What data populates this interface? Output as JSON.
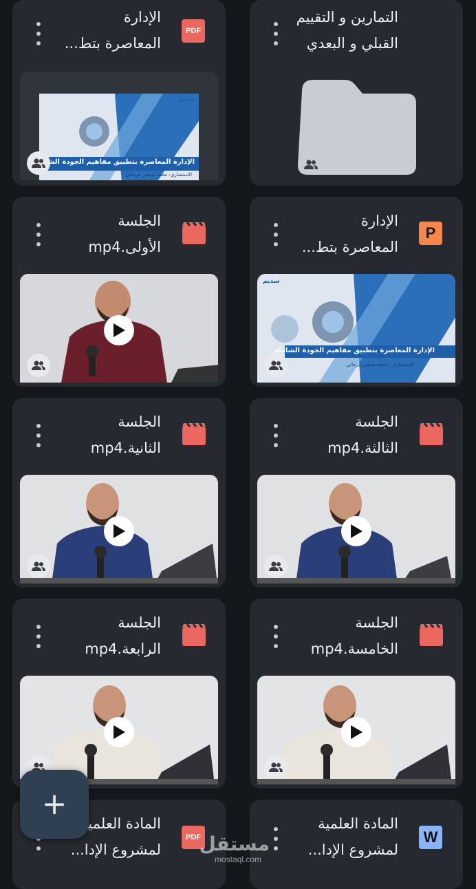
{
  "items": [
    {
      "title_line1": "التمارين و التقييم",
      "title_line2": "القبلي و البعدي",
      "type_icon": "folder"
    },
    {
      "title_line1": "الإدارة",
      "title_line2": "المعاصرة بتط...",
      "type_icon": "pdf-icon",
      "badge": "PDF",
      "thumb_title": "الإدارة المعاصرة بتطبيق مفاهيم الجودة الشاملة",
      "thumb_sub": "الاستشاري: محمد صبحي مرجاني",
      "thumb_brand": "سديم"
    },
    {
      "title_line1": "الإدارة",
      "title_line2": "المعاصرة بتط...",
      "type_icon": "presentation-icon",
      "badge": "P",
      "thumb_title": "الإدارة المعاصرة بتطبيق مفاهيم الجودة الشاملة",
      "thumb_sub": "الإستشاري : محمد صبحي مرجاني",
      "thumb_brand": "سديم"
    },
    {
      "title_line1": "الجلسة",
      "title_line2": "الأولى.mp4",
      "type_icon": "video-icon"
    },
    {
      "title_line1": "الجلسة",
      "title_line2": "الثالثة.mp4",
      "type_icon": "video-icon"
    },
    {
      "title_line1": "الجلسة",
      "title_line2": "الثانية.mp4",
      "type_icon": "video-icon"
    },
    {
      "title_line1": "الجلسة",
      "title_line2": "الخامسة.mp4",
      "type_icon": "video-icon"
    },
    {
      "title_line1": "الجلسة",
      "title_line2": "الرابعة.mp4",
      "type_icon": "video-icon"
    },
    {
      "title_line1": "المادة العلمية",
      "title_line2": "لمشروع الإدا...",
      "type_icon": "word-icon",
      "badge": "W"
    },
    {
      "title_line1": "المادة العلمية",
      "title_line2": "لمشروع الإدا...",
      "type_icon": "pdf-icon",
      "badge": "PDF"
    }
  ],
  "fab": {
    "symbol": "+"
  },
  "watermark": {
    "arabic": "مستقل",
    "latin": "mostaql.com"
  },
  "colors": {
    "background": "#14171c",
    "card": "#262a30",
    "pdf": "#ea6860",
    "video": "#ea6860",
    "presentation": "#f5874d",
    "word": "#8ab4f8"
  }
}
